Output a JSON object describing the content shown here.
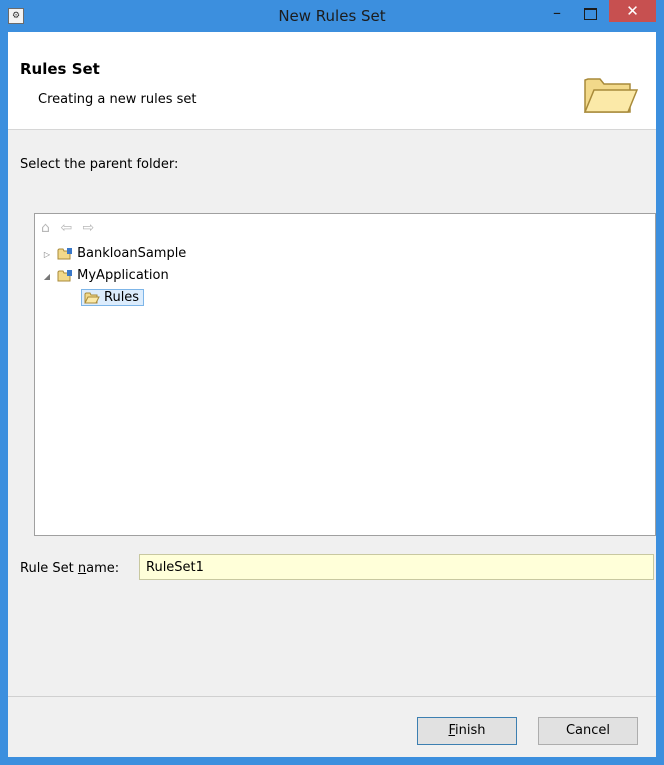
{
  "window": {
    "title": "New Rules Set"
  },
  "header": {
    "title": "Rules Set",
    "subtitle": "Creating a new rules set"
  },
  "prompt": "Select the parent folder:",
  "tree": {
    "nav": [
      "home-icon",
      "back-arrow-icon",
      "forward-arrow-icon"
    ],
    "nodes": [
      {
        "label": "BankloanSample",
        "expanded": false
      },
      {
        "label": "MyApplication",
        "expanded": true
      },
      {
        "label": "Rules",
        "selected": true
      }
    ]
  },
  "form": {
    "label_prefix": "Rule Set ",
    "label_mnemonic": "n",
    "label_suffix": "ame:",
    "value": "RuleSet1"
  },
  "buttons": {
    "finish_mnemonic": "F",
    "finish_rest": "inish",
    "cancel": "Cancel"
  },
  "colors": {
    "titlebar": "#3c8fde",
    "close": "#c75050",
    "input_bg": "#ffffd9",
    "selection": "#dcecfc"
  }
}
